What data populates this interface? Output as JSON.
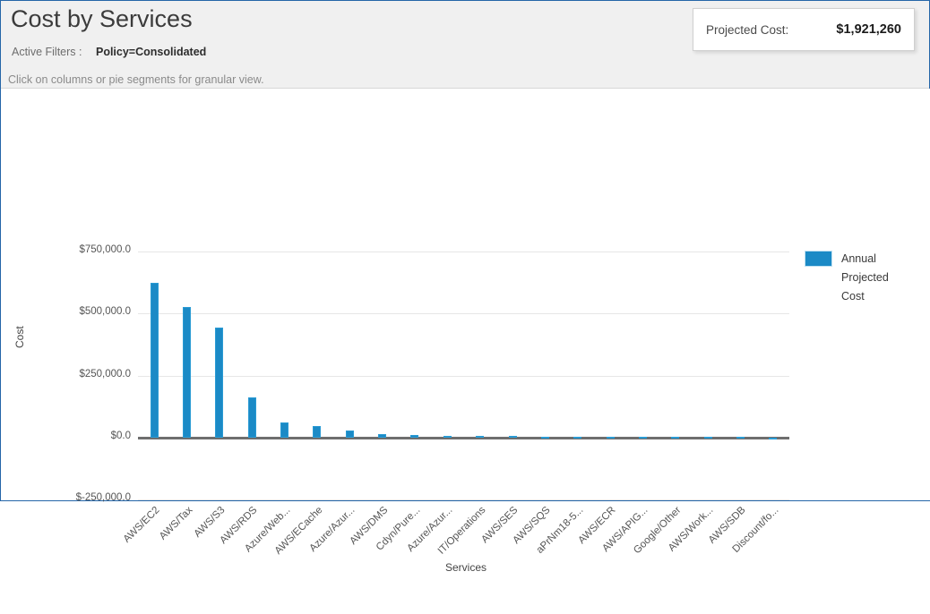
{
  "header": {
    "title": "Cost by Services",
    "filters_label": "Active Filters :",
    "filters_value": "Policy=Consolidated",
    "hint": "Click on columns or pie segments for granular view.",
    "projected_cost_label": "Projected Cost:",
    "projected_cost_value": "$1,921,260"
  },
  "legend": {
    "entries": [
      {
        "label": "Annual Projected Cost",
        "color": "#1b8ac6"
      }
    ]
  },
  "colors": {
    "bar": "#1b8ac6",
    "bar_border": "#2a9bd4",
    "header_bg": "#f0f0f0",
    "frame_border": "#2566a8",
    "gridline": "#e6e6e6",
    "axis": "#6e6e6e"
  },
  "chart_data": {
    "type": "bar",
    "title": "Cost by Services",
    "xlabel": "Services",
    "ylabel": "Cost",
    "ylim": [
      -250000,
      750000
    ],
    "ytick_labels": [
      "$750,000.0",
      "$500,000.0",
      "$250,000.0",
      "$0.0",
      "$-250,000.0"
    ],
    "ytick_values": [
      750000,
      500000,
      250000,
      0,
      -250000
    ],
    "grid": true,
    "legend_position": "right",
    "categories": [
      "AWS/EC2",
      "AWS/Tax",
      "AWS/S3",
      "AWS/RDS",
      "Azure/Web...",
      "AWS/ECache",
      "Azure/Azur...",
      "AWS/DMS",
      "Cdyn/Pure...",
      "Azure/Azur...",
      "IT/Operations",
      "AWS/SES",
      "AWS/SQS",
      "aPrNm18-5...",
      "AWS/ECR",
      "AWS/APIG...",
      "Google/Other",
      "AWS/Work...",
      "AWS/SDB",
      "Discount/fo..."
    ],
    "series": [
      {
        "name": "Annual Projected Cost",
        "color": "#1b8ac6",
        "values": [
          623000,
          525000,
          442000,
          163000,
          62000,
          47000,
          29000,
          15000,
          10000,
          7000,
          6000,
          5000,
          4000,
          3500,
          3000,
          2500,
          2000,
          1800,
          1500,
          -9000
        ]
      }
    ]
  }
}
